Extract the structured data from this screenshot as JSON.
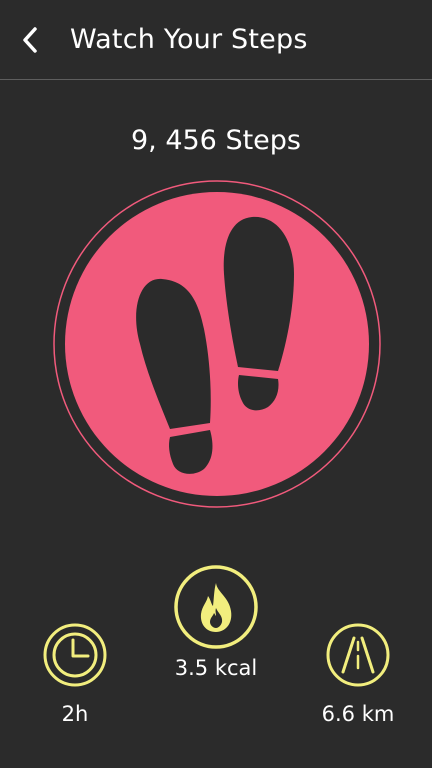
{
  "header": {
    "title": "Watch Your Steps",
    "back_icon": "chevron-left-icon"
  },
  "steps": {
    "count_text": "9, 456 Steps",
    "icon": "footprints-icon"
  },
  "stats": {
    "duration": {
      "value": "2h",
      "icon": "clock-icon"
    },
    "calories": {
      "value": "3.5 kcal",
      "icon": "flame-icon"
    },
    "distance": {
      "value": "6.6 km",
      "icon": "road-icon"
    }
  },
  "colors": {
    "background": "#2b2b2b",
    "accent_pink": "#f15a7c",
    "accent_yellow": "#f2ee7e",
    "text": "#ffffff"
  }
}
